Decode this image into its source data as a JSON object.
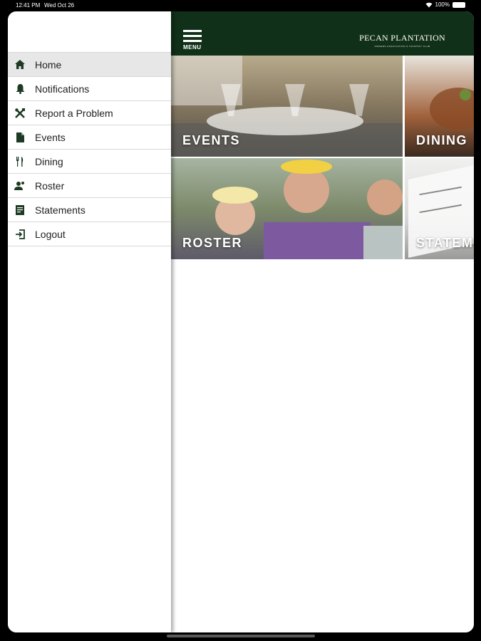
{
  "status_bar": {
    "time": "12:41 PM",
    "date": "Wed Oct 26",
    "battery": "100%"
  },
  "drawer": {
    "items": [
      {
        "label": "Home",
        "icon": "home-icon",
        "active": true
      },
      {
        "label": "Notifications",
        "icon": "bell-icon"
      },
      {
        "label": "Report a Problem",
        "icon": "tools-icon"
      },
      {
        "label": "Events",
        "icon": "document-icon"
      },
      {
        "label": "Dining",
        "icon": "utensils-icon"
      },
      {
        "label": "Roster",
        "icon": "people-icon"
      },
      {
        "label": "Statements",
        "icon": "statement-icon"
      },
      {
        "label": "Logout",
        "icon": "logout-icon"
      }
    ]
  },
  "header": {
    "menu_label": "MENU",
    "logo_name": "PECAN PLANTATION",
    "logo_sub": "OWNERS ASSOCIATION & COUNTRY CLUB",
    "background": "#113019"
  },
  "tiles": [
    {
      "label": "EVENTS"
    },
    {
      "label": "DINING"
    },
    {
      "label": "ROSTER"
    },
    {
      "label": "STATEMENTS"
    }
  ]
}
